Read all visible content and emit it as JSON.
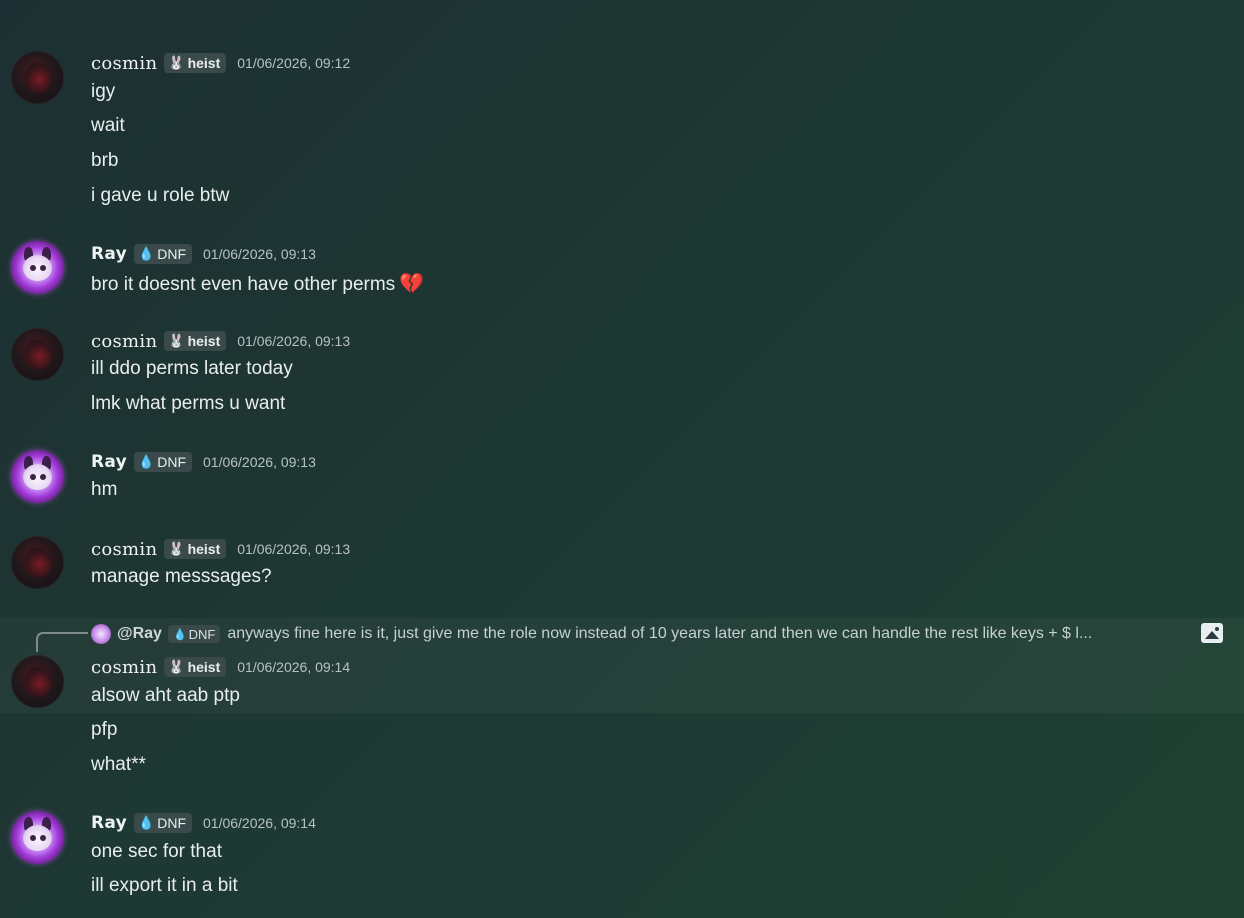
{
  "messages": [
    {
      "author": "cosmin",
      "tag": "heist",
      "tag_icon": "🐰",
      "time": "01/06/2026, 09:12",
      "lines": [
        "igy",
        "wait",
        "brb",
        "i gave u role btw"
      ]
    },
    {
      "author": "Ray",
      "tag": "DNF",
      "tag_icon": "💧",
      "time": "01/06/2026, 09:13",
      "lines": [
        "bro it doesnt even have other perms"
      ],
      "emoji": "💔"
    },
    {
      "author": "cosmin",
      "tag": "heist",
      "tag_icon": "🐰",
      "time": "01/06/2026, 09:13",
      "lines": [
        "ill ddo perms later today",
        "lmk what perms u want"
      ]
    },
    {
      "author": "Ray",
      "tag": "DNF",
      "tag_icon": "💧",
      "time": "01/06/2026, 09:13",
      "lines": [
        "hm"
      ]
    },
    {
      "author": "cosmin",
      "tag": "heist",
      "tag_icon": "🐰",
      "time": "01/06/2026, 09:13",
      "lines": [
        "manage messsages?"
      ]
    },
    {
      "reply": {
        "name": "@Ray",
        "tag": "DNF",
        "tag_icon": "💧",
        "text": "anyways fine here is it, just give me the role now instead of 10 years later and then we can handle the rest like keys + $ l..."
      },
      "author": "cosmin",
      "tag": "heist",
      "tag_icon": "🐰",
      "time": "01/06/2026, 09:14",
      "lines": [
        "alsow aht aab ptp",
        "pfp",
        "what**"
      ]
    },
    {
      "author": "Ray",
      "tag": "DNF",
      "tag_icon": "💧",
      "time": "01/06/2026, 09:14",
      "lines": [
        "one sec for that",
        "ill export it in a bit"
      ]
    }
  ]
}
